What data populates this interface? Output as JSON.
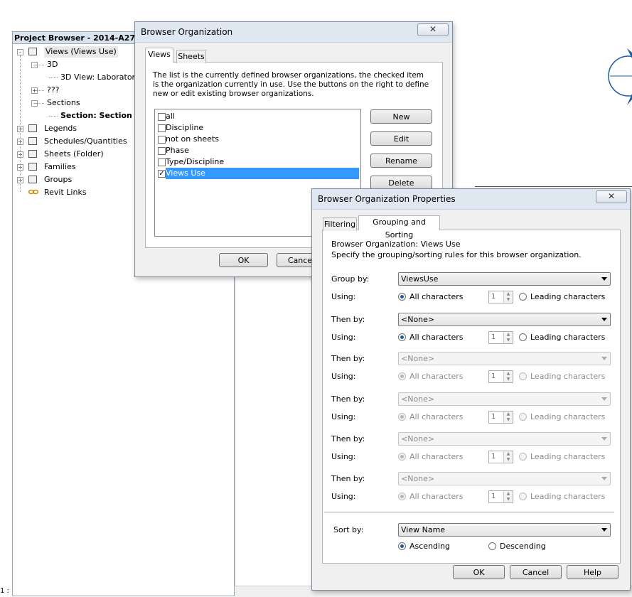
{
  "project_browser": {
    "title": "Project Browser - 2014-A274-DRWG",
    "tree": [
      {
        "label": "Views (Views Use)",
        "toggle": "-",
        "icon": "views-icon"
      },
      {
        "label": "3D",
        "toggle": "-"
      },
      {
        "label": "3D View: Laboratory"
      },
      {
        "label": "???",
        "toggle": "+"
      },
      {
        "label": "Sections",
        "toggle": "-"
      },
      {
        "label": "Section: Section 1"
      },
      {
        "label": "Legends",
        "toggle": "+",
        "icon": "legends-icon"
      },
      {
        "label": "Schedules/Quantities",
        "toggle": "+",
        "icon": "schedules-icon"
      },
      {
        "label": "Sheets (Folder)",
        "toggle": "+",
        "icon": "sheets-icon"
      },
      {
        "label": "Families",
        "toggle": "+",
        "icon": "families-icon"
      },
      {
        "label": "Groups",
        "toggle": "+",
        "icon": "groups-icon"
      },
      {
        "label": "Revit Links",
        "icon": "revit-links-icon"
      }
    ]
  },
  "status": {
    "scale_fragment": "1 :"
  },
  "browser_org": {
    "title": "Browser Organization",
    "close_glyph": "✕",
    "tabs": [
      "Views",
      "Sheets"
    ],
    "description": "The list is the currently defined browser organizations,  the checked item is the organization currently in use. Use the buttons on the right to define new or edit existing browser organizations.",
    "items": [
      {
        "label": "all",
        "checked": false
      },
      {
        "label": "Discipline",
        "checked": false
      },
      {
        "label": "not on sheets",
        "checked": false
      },
      {
        "label": "Phase",
        "checked": false
      },
      {
        "label": "Type/Discipline",
        "checked": false
      },
      {
        "label": "Views Use",
        "checked": true
      }
    ],
    "buttons": {
      "new": "New",
      "edit": "Edit",
      "rename": "Rename",
      "delete": "Delete"
    },
    "ok": "OK",
    "cancel": "Cancel"
  },
  "props": {
    "title": "Browser Organization Properties",
    "close_glyph": "✕",
    "tabs": [
      "Filtering",
      "Grouping and Sorting"
    ],
    "line1": "Browser Organization: Views Use",
    "line2": "Specify the grouping/sorting rules for this browser organization.",
    "group_label": "Group by:",
    "then_label": "Then by:",
    "using_label": "Using:",
    "all_chars": "All characters",
    "leading_chars": "Leading characters",
    "spin_value": "1",
    "rows": [
      {
        "value": "ViewsUse",
        "enabled": true
      },
      {
        "value": "<None>",
        "enabled": true
      },
      {
        "value": "<None>",
        "enabled": false
      },
      {
        "value": "<None>",
        "enabled": false
      },
      {
        "value": "<None>",
        "enabled": false
      },
      {
        "value": "<None>",
        "enabled": false
      }
    ],
    "sort_label": "Sort by:",
    "sort_value": "View Name",
    "ascending": "Ascending",
    "descending": "Descending",
    "ok": "OK",
    "cancel": "Cancel",
    "help": "Help"
  },
  "colors": {
    "selection": "#3399ff",
    "accent_blue": "#1d5aa8"
  }
}
